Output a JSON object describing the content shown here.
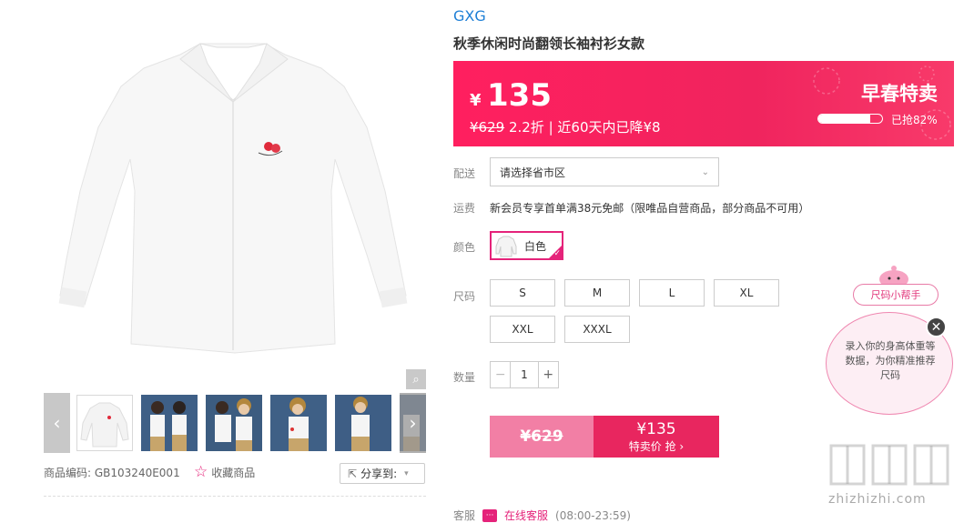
{
  "product": {
    "brand": "GXG",
    "title": "秋季休闲时尚翻领长袖衬衫女款",
    "code_label": "商品编码:",
    "code": "GB103240E001",
    "fav_label": "收藏商品",
    "share_label": "分享到:"
  },
  "banner": {
    "currency": "¥",
    "price": "135",
    "original": "¥629",
    "discount_note": " 2.2折 | 近60天内已降¥8",
    "promo_title": "早春特卖",
    "sold_text": "已抢82%",
    "sold_fraction": 0.82,
    "color": "#ff1f5f"
  },
  "delivery": {
    "label": "配送",
    "placeholder": "请选择省市区"
  },
  "shipping": {
    "label": "运费",
    "text": "新会员专享首单满38元免邮（限唯品自营商品，部分商品不可用）"
  },
  "color": {
    "label": "颜色",
    "selected": "白色"
  },
  "size": {
    "label": "尺码",
    "options": [
      "S",
      "M",
      "L",
      "XL",
      "XXL",
      "XXXL"
    ]
  },
  "quantity": {
    "label": "数量",
    "value": "1",
    "minus": "−",
    "plus": "+"
  },
  "buy": {
    "orig_price": "¥629",
    "price": "¥135",
    "action": "特卖价 抢 ›"
  },
  "service": {
    "label": "客服",
    "link": "在线客服",
    "hours": "(08:00-23:59)"
  },
  "size_helper": {
    "title": "尺码小帮手",
    "text": "录入你的身高体重等数据，为你精准推荐尺码"
  },
  "watermark": {
    "text": "zhizhizhi.com"
  }
}
